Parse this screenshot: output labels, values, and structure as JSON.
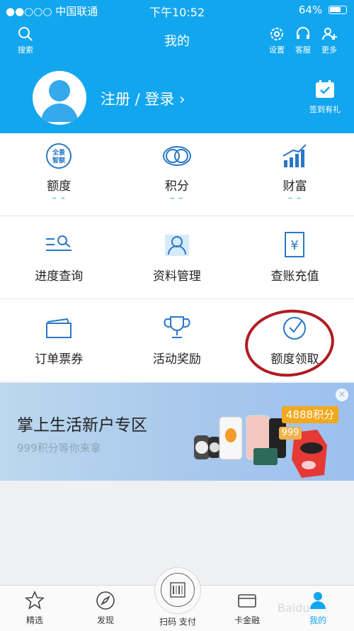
{
  "status": {
    "carrier": "●●○○○ 中国联通",
    "time": "下午10:52",
    "battery": "64%"
  },
  "nav": {
    "title": "我的",
    "search_label": "搜索",
    "settings_label": "设置",
    "service_label": "客服",
    "more_label": "更多"
  },
  "profile": {
    "login_text": "注册 / 登录 ›",
    "checkin_label": "签到有礼"
  },
  "grid": {
    "row1": [
      {
        "label": "额度",
        "dash": "– –",
        "icon": "quota-badge-icon",
        "icon_text_top": "全景",
        "icon_text_bottom": "智额"
      },
      {
        "label": "积分",
        "dash": "– –",
        "icon": "points-rings-icon"
      },
      {
        "label": "财富",
        "dash": "– –",
        "icon": "wealth-chart-icon"
      }
    ],
    "row2": [
      {
        "label": "进度查询",
        "icon": "progress-search-icon"
      },
      {
        "label": "资料管理",
        "icon": "profile-manage-icon"
      },
      {
        "label": "查账充值",
        "icon": "bill-yuan-icon",
        "icon_text": "¥"
      }
    ],
    "row3": [
      {
        "label": "订单票券",
        "icon": "ticket-icon"
      },
      {
        "label": "活动奖励",
        "icon": "trophy-icon"
      },
      {
        "label": "额度领取",
        "icon": "clock-check-icon"
      }
    ]
  },
  "banner": {
    "title": "掌上生活新户专区",
    "subtitle": "999积分等你来拿",
    "badge_points": "4888积分",
    "badge_999": "999"
  },
  "tabbar": {
    "tabs": [
      {
        "label": "精选",
        "icon": "star-icon"
      },
      {
        "label": "发现",
        "icon": "compass-icon"
      },
      {
        "label": "扫码 支付",
        "icon": "scan-icon"
      },
      {
        "label": "卡金融",
        "icon": "card-icon"
      },
      {
        "label": "我的",
        "icon": "user-icon"
      }
    ],
    "watermark": "Baidu"
  },
  "colors": {
    "brand_blue": "#12a6ef",
    "annotation_red": "#b01b22"
  }
}
